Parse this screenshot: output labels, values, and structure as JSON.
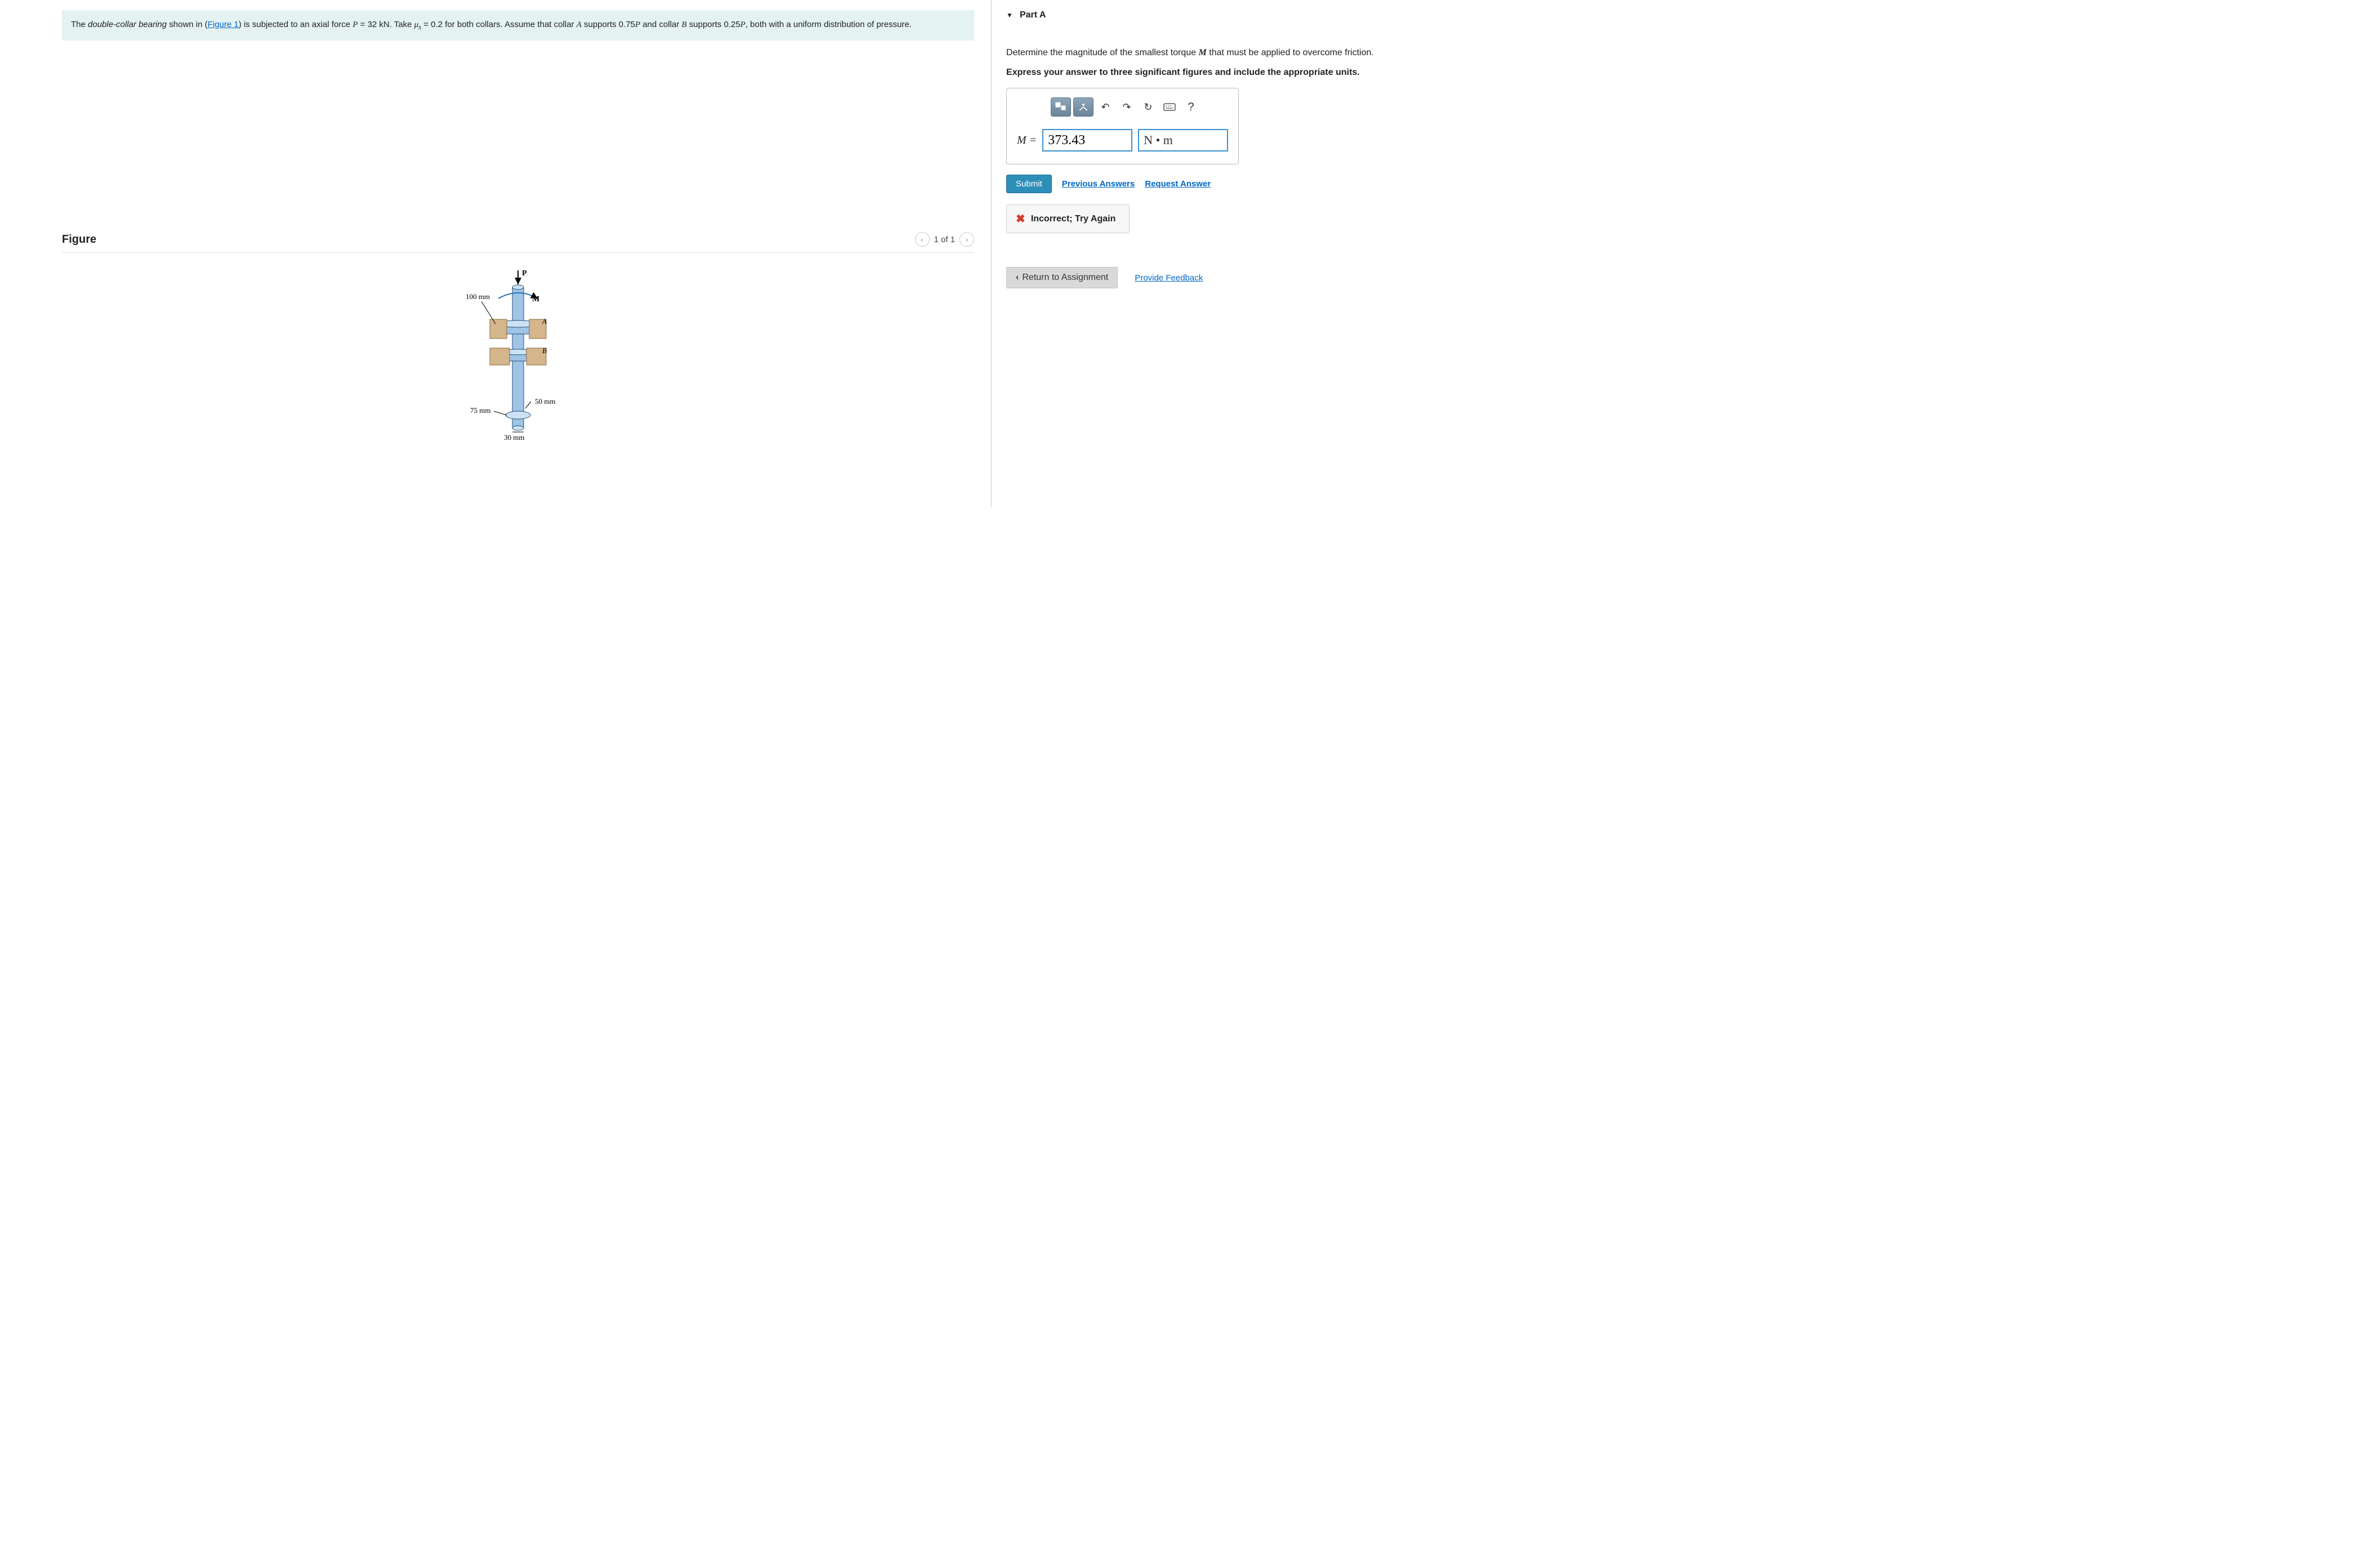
{
  "problem": {
    "text_parts": {
      "p1": "The ",
      "term": "double-collar bearing",
      "p2": " shown in (",
      "fig_link": "Figure 1",
      "p3": ") is subjected to an axial force ",
      "varP": "P",
      "p4": " = 32 kN. Take ",
      "mu": "μ",
      "sub_s": "s",
      "p5": " = 0.2 for both collars. Assume that collar ",
      "varA": "A",
      "p6": " supports 0.75",
      "varP2": "P",
      "p7": " and collar ",
      "varB": "B",
      "p8": " supports 0.25",
      "varP3": "P",
      "p9": ", both with a uniform distribution of pressure."
    }
  },
  "part": {
    "label": "Part A",
    "question_pre": "Determine the magnitude of the smallest torque ",
    "question_var": "M",
    "question_post": " that must be applied to overcome friction.",
    "instruction": "Express your answer to three significant figures and include the appropriate units."
  },
  "answer": {
    "label": "M = ",
    "value": "373.43",
    "unit": "N • m"
  },
  "actions": {
    "submit": "Submit",
    "previous": "Previous Answers",
    "request": "Request Answer"
  },
  "feedback": {
    "text": "Incorrect; Try Again"
  },
  "footer": {
    "return": "Return to Assignment",
    "feedback_link": "Provide Feedback"
  },
  "figure": {
    "title": "Figure",
    "nav": "1 of 1",
    "labels": {
      "P": "P",
      "M": "M",
      "A": "A",
      "B": "B",
      "d100": "100 mm",
      "d75": "75 mm",
      "d50": "50 mm",
      "d30": "30 mm"
    }
  },
  "toolbar": {
    "help": "?"
  }
}
